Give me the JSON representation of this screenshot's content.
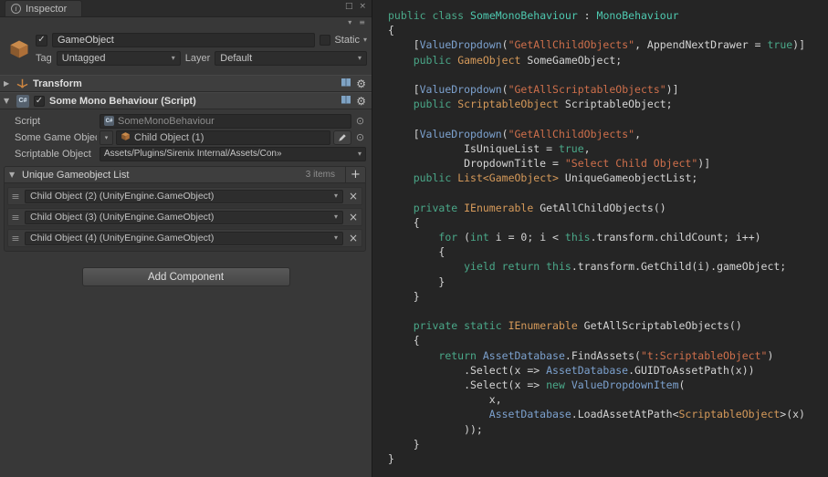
{
  "window": {
    "tab_title": "Inspector"
  },
  "icons": {
    "info": "i",
    "check": "✓",
    "dropdown": "▾",
    "foldout_open": "▼",
    "foldout_closed": "▶",
    "gear": "⚙",
    "picker": "⊙",
    "handle": "≡",
    "menu": "≡",
    "close": "×",
    "remove": "×",
    "add": "+",
    "square": "□",
    "csharp": "C#"
  },
  "colors": {
    "panel_bg": "#383838",
    "code_bg": "#252525",
    "tok_p": "#D4D4D4",
    "tok_k": "#4AA889",
    "tok_g": "#4EC9B0",
    "tok_t": "#D69A5A",
    "tok_s": "#CE6F4B",
    "tok_c": "#7CA1CE"
  },
  "header": {
    "name": "GameObject",
    "static_label": "Static",
    "tag_label": "Tag",
    "tag_value": "Untagged",
    "layer_label": "Layer",
    "layer_value": "Default"
  },
  "transform": {
    "title": "Transform"
  },
  "mono": {
    "title": "Some Mono Behaviour (Script)",
    "script_label": "Script",
    "script_value": "SomeMonoBehaviour",
    "game_object_label": "Some Game Object",
    "game_object_value": "Child Object (1)",
    "scriptable_label": "Scriptable Object",
    "scriptable_value": "Assets/Plugins/Sirenix Internal/Assets/Con»"
  },
  "list": {
    "title": "Unique Gameobject List",
    "count": "3 items",
    "items": [
      "Child Object (2) (UnityEngine.GameObject)",
      "Child Object (3) (UnityEngine.GameObject)",
      "Child Object (4) (UnityEngine.GameObject)"
    ]
  },
  "add_component": "Add Component",
  "code": {
    "lines": [
      [
        [
          "k",
          "public"
        ],
        [
          "p",
          " "
        ],
        [
          "k",
          "class"
        ],
        [
          "p",
          " "
        ],
        [
          "g",
          "SomeMonoBehaviour"
        ],
        [
          "p",
          " : "
        ],
        [
          "g",
          "MonoBehaviour"
        ]
      ],
      [
        [
          "p",
          "{"
        ]
      ],
      [
        [
          "p",
          "    ["
        ],
        [
          "c",
          "ValueDropdown"
        ],
        [
          "p",
          "("
        ],
        [
          "s",
          "\"GetAllChildObjects\""
        ],
        [
          "p",
          ", AppendNextDrawer = "
        ],
        [
          "k",
          "true"
        ],
        [
          "p",
          ")]"
        ]
      ],
      [
        [
          "p",
          "    "
        ],
        [
          "k",
          "public"
        ],
        [
          "p",
          " "
        ],
        [
          "t",
          "GameObject"
        ],
        [
          "p",
          " SomeGameObject;"
        ]
      ],
      [],
      [
        [
          "p",
          "    ["
        ],
        [
          "c",
          "ValueDropdown"
        ],
        [
          "p",
          "("
        ],
        [
          "s",
          "\"GetAllScriptableObjects\""
        ],
        [
          "p",
          ")]"
        ]
      ],
      [
        [
          "p",
          "    "
        ],
        [
          "k",
          "public"
        ],
        [
          "p",
          " "
        ],
        [
          "t",
          "ScriptableObject"
        ],
        [
          "p",
          " ScriptableObject;"
        ]
      ],
      [],
      [
        [
          "p",
          "    ["
        ],
        [
          "c",
          "ValueDropdown"
        ],
        [
          "p",
          "("
        ],
        [
          "s",
          "\"GetAllChildObjects\""
        ],
        [
          "p",
          ","
        ]
      ],
      [
        [
          "p",
          "            IsUniqueList = "
        ],
        [
          "k",
          "true"
        ],
        [
          "p",
          ","
        ]
      ],
      [
        [
          "p",
          "            DropdownTitle = "
        ],
        [
          "s",
          "\"Select Child Object\""
        ],
        [
          "p",
          ")]"
        ]
      ],
      [
        [
          "p",
          "    "
        ],
        [
          "k",
          "public"
        ],
        [
          "p",
          " "
        ],
        [
          "t",
          "List<GameObject>"
        ],
        [
          "p",
          " UniqueGameobjectList;"
        ]
      ],
      [],
      [
        [
          "p",
          "    "
        ],
        [
          "k",
          "private"
        ],
        [
          "p",
          " "
        ],
        [
          "t",
          "IEnumerable"
        ],
        [
          "p",
          " GetAllChildObjects()"
        ]
      ],
      [
        [
          "p",
          "    {"
        ]
      ],
      [
        [
          "p",
          "        "
        ],
        [
          "k",
          "for"
        ],
        [
          "p",
          " ("
        ],
        [
          "k",
          "int"
        ],
        [
          "p",
          " i = 0; i < "
        ],
        [
          "k",
          "this"
        ],
        [
          "p",
          ".transform.childCount; i++)"
        ]
      ],
      [
        [
          "p",
          "        {"
        ]
      ],
      [
        [
          "p",
          "            "
        ],
        [
          "k",
          "yield return"
        ],
        [
          "p",
          " "
        ],
        [
          "k",
          "this"
        ],
        [
          "p",
          ".transform.GetChild(i).gameObject;"
        ]
      ],
      [
        [
          "p",
          "        }"
        ]
      ],
      [
        [
          "p",
          "    }"
        ]
      ],
      [],
      [
        [
          "p",
          "    "
        ],
        [
          "k",
          "private static"
        ],
        [
          "p",
          " "
        ],
        [
          "t",
          "IEnumerable"
        ],
        [
          "p",
          " GetAllScriptableObjects()"
        ]
      ],
      [
        [
          "p",
          "    {"
        ]
      ],
      [
        [
          "p",
          "        "
        ],
        [
          "k",
          "return"
        ],
        [
          "p",
          " "
        ],
        [
          "c",
          "AssetDatabase"
        ],
        [
          "p",
          ".FindAssets("
        ],
        [
          "s",
          "\"t:ScriptableObject\""
        ],
        [
          "p",
          ")"
        ]
      ],
      [
        [
          "p",
          "            .Select(x => "
        ],
        [
          "c",
          "AssetDatabase"
        ],
        [
          "p",
          ".GUIDToAssetPath(x))"
        ]
      ],
      [
        [
          "p",
          "            .Select(x => "
        ],
        [
          "k",
          "new"
        ],
        [
          "p",
          " "
        ],
        [
          "c",
          "ValueDropdownItem"
        ],
        [
          "p",
          "("
        ]
      ],
      [
        [
          "p",
          "                x,"
        ]
      ],
      [
        [
          "p",
          "                "
        ],
        [
          "c",
          "AssetDatabase"
        ],
        [
          "p",
          ".LoadAssetAtPath<"
        ],
        [
          "t",
          "ScriptableObject"
        ],
        [
          "p",
          ">(x)"
        ]
      ],
      [
        [
          "p",
          "            ));"
        ]
      ],
      [
        [
          "p",
          "    }"
        ]
      ],
      [
        [
          "p",
          "}"
        ]
      ]
    ]
  }
}
